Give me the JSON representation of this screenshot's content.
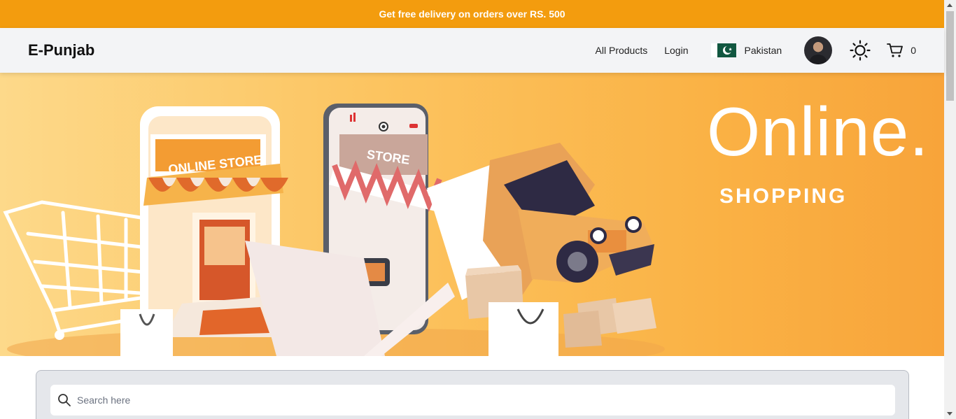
{
  "promo": {
    "text": "Get free delivery on orders over RS. 500"
  },
  "header": {
    "brand": "E-Punjab",
    "nav": {
      "all_products": "All Products",
      "login": "Login"
    },
    "country": {
      "name": "Pakistan"
    },
    "cart": {
      "count": "0"
    }
  },
  "hero": {
    "title": "Online.",
    "subtitle": "SHOPPING",
    "illustration_labels": {
      "online_store": "ONLINE STORE",
      "store": "STORE"
    }
  },
  "search": {
    "placeholder": "Search here"
  },
  "icons": {
    "flag": "pakistan-flag-icon",
    "theme": "sun-icon",
    "cart": "cart-icon",
    "search": "search-icon"
  },
  "colors": {
    "promo": "#f39c0e",
    "navbar": "#f3f4f6",
    "hero_start": "#fdd98a",
    "hero_end": "#f8a43a"
  }
}
